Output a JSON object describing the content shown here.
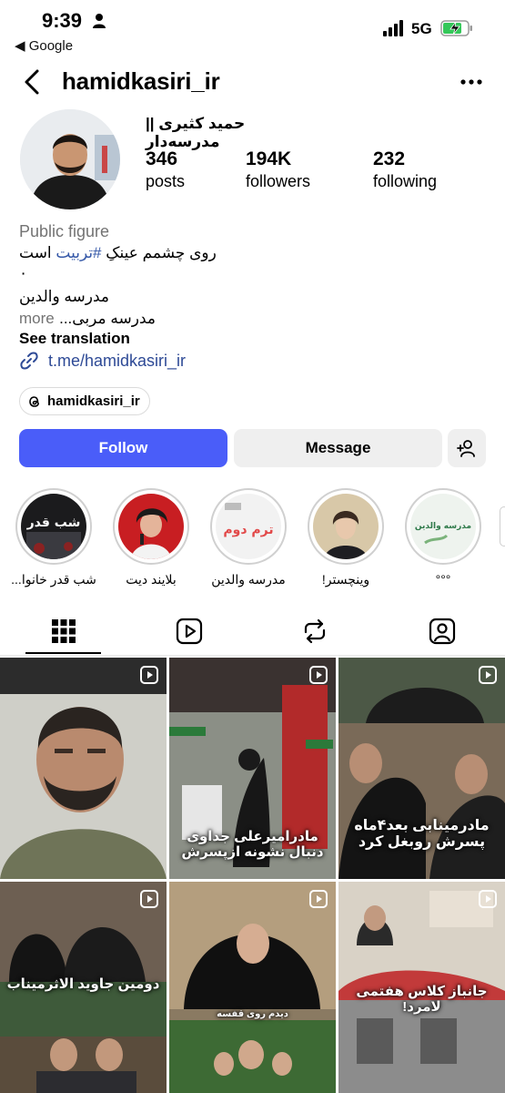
{
  "status_bar": {
    "time": "9:39",
    "back_app": "◀ Google",
    "network": "5G"
  },
  "header": {
    "username": "hamidkasiri_ir"
  },
  "profile": {
    "full_name": "حمید کثیری || مدرسه‌دار",
    "stats": [
      {
        "value": "346",
        "label": "posts"
      },
      {
        "value": "194K",
        "label": "followers"
      },
      {
        "value": "232",
        "label": "following"
      }
    ],
    "category": "Public figure",
    "bio_line1_pre": "روی چشمم عینکِ ",
    "bio_line1_tag": "#تربیت",
    "bio_line1_post": " است",
    "bio_line2": "۰",
    "bio_line3": "مدرسه والدین",
    "bio_more_text": "مدرسه مربی...",
    "bio_more_label": "more",
    "see_translation": "See translation",
    "link": "t.me/hamidkasiri_ir",
    "threads_handle": "hamidkasiri_ir"
  },
  "actions": {
    "follow": "Follow",
    "message": "Message"
  },
  "highlights": [
    {
      "label": "شب قدر خانوا...",
      "cover_text": "شب قدر"
    },
    {
      "label": "بلایند دیت",
      "cover_text": ""
    },
    {
      "label": "مدرسه والدین",
      "cover_text": "ترم دوم"
    },
    {
      "label": "وینچستر!",
      "cover_text": ""
    },
    {
      "label": "°°°",
      "cover_text": "مدرسه والدین"
    }
  ],
  "tabs": [
    "grid",
    "reels",
    "reposts",
    "tagged"
  ],
  "posts": [
    {
      "caption": ""
    },
    {
      "caption": "مادرامیرعلی جداوی دنبال نشونه ازپسرش"
    },
    {
      "caption": "مادرمینابی بعد۴ماه پسرش روبغل کرد"
    },
    {
      "caption": "دومین جاوید الاثرمیناب"
    },
    {
      "caption": "دیدم روی قفسه"
    },
    {
      "caption": "جانباز کلاس هفتمی لامرد!"
    }
  ]
}
